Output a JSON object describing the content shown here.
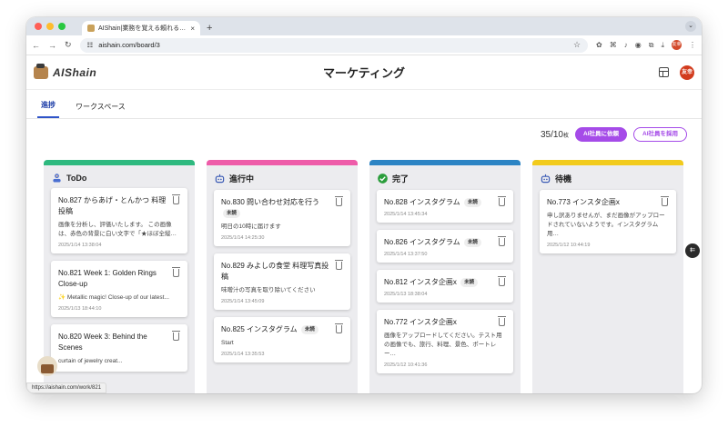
{
  "browser": {
    "tab_title": "AIShain|業務を覚える頼れる社員",
    "tab_close": "×",
    "new_tab": "+",
    "tab_menu": "⌄",
    "url": "aishain.com/board/3",
    "status_url": "https://aishain.com/work/821",
    "profile_initials": "友幸"
  },
  "app": {
    "logo_text": "AIShain",
    "page_title": "マーケティング",
    "user_initials": "友幸",
    "tabs": [
      "進捗",
      "ワークスペース"
    ]
  },
  "actions": {
    "quota_main": "35/10",
    "quota_unit": "枚",
    "request_label": "AI社員に依頼",
    "hire_label": "AI社員を採用"
  },
  "colors": {
    "todo": "#2eb97f",
    "inprogress": "#ee5ca9",
    "done": "#2c84c4",
    "waiting": "#f2cb1d",
    "accent": "#a54be8"
  },
  "columns": [
    {
      "title": "ToDo",
      "icon": "person-icon",
      "cards": [
        {
          "title": "No.827 からあげ・とんかつ 料理投稿",
          "badge": "",
          "desc": "画像を分析し、評価いたします。 この画像は、赤色の背景に白い文字で「★ほぼ全縦…",
          "ts": "2025/1/14 13:38:04"
        },
        {
          "title": "No.821 Week 1: Golden Rings Close-up",
          "badge": "",
          "desc": "✨ Metallic magic! Close-up of our latest...",
          "ts": "2025/1/13 18:44:10"
        },
        {
          "title": "No.820 Week 3: Behind the Scenes",
          "badge": "",
          "desc": "curtain of jewelry creat...",
          "ts": ""
        }
      ]
    },
    {
      "title": "進行中",
      "icon": "robot-icon",
      "cards": [
        {
          "title": "No.830 問い合わせ対応を行う",
          "badge": "未読",
          "desc": "明日の10時に届けます",
          "ts": "2025/1/14 14:25:30"
        },
        {
          "title": "No.829 みよしの食堂 料理写真投稿",
          "badge": "",
          "desc": "味噌汁の写真を取り除いてください",
          "ts": "2025/1/14 13:45:09"
        },
        {
          "title": "No.825 インスタグラム",
          "badge": "未読",
          "desc": "Start",
          "ts": "2025/1/14 13:35:53"
        }
      ]
    },
    {
      "title": "完了",
      "icon": "check-circle-icon",
      "cards": [
        {
          "title": "No.828 インスタグラム",
          "badge": "未読",
          "desc": "",
          "ts": "2025/1/14 13:45:34"
        },
        {
          "title": "No.826 インスタグラム",
          "badge": "未読",
          "desc": "",
          "ts": "2025/1/14 13:37:50"
        },
        {
          "title": "No.812 インスタ企画x",
          "badge": "未読",
          "desc": "",
          "ts": "2025/1/13 18:38:04"
        },
        {
          "title": "No.772 インスタ企画x",
          "badge": "",
          "desc": "画像をアップロードしてください。テスト用の画像でも、旅行、料理、景色、ポートレー…",
          "ts": "2025/1/12 10:41:36"
        }
      ]
    },
    {
      "title": "待機",
      "icon": "robot-icon",
      "cards": [
        {
          "title": "No.773 インスタ企画x",
          "badge": "",
          "desc": "申し訳ありませんが、まだ画像がアップロードされていないようです。インスタグラム用…",
          "ts": "2025/1/12 10:44:19"
        }
      ]
    }
  ]
}
